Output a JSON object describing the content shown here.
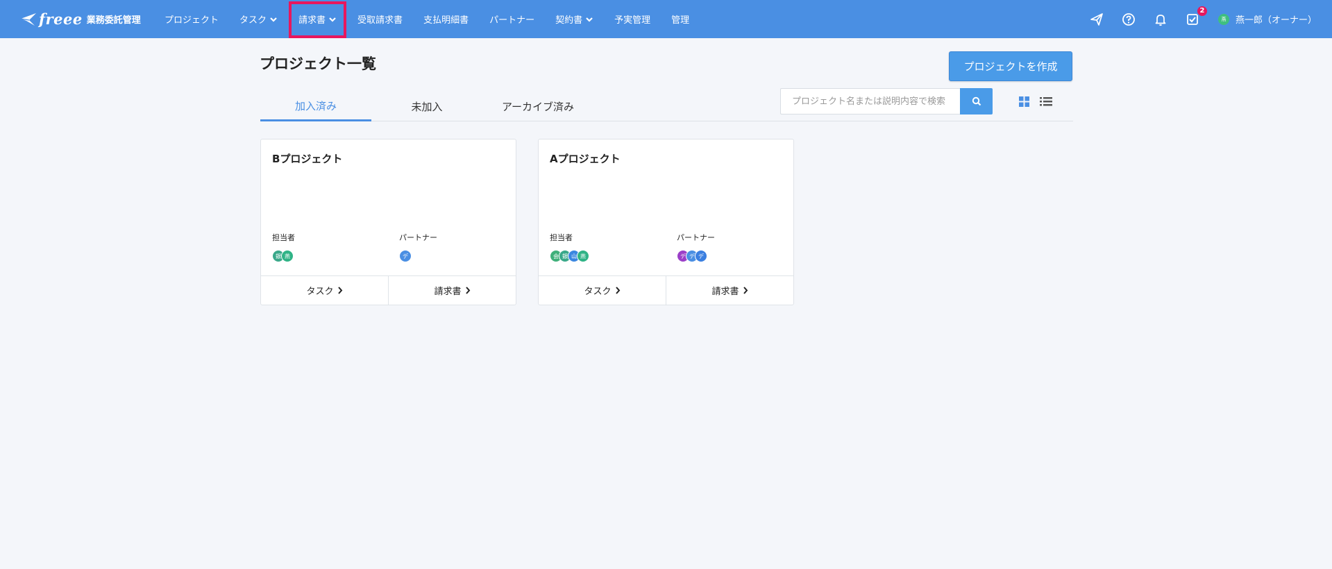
{
  "header": {
    "brand": "freee",
    "brand_sub": "業務委託管理",
    "nav": [
      {
        "label": "プロジェクト",
        "dropdown": false
      },
      {
        "label": "タスク",
        "dropdown": true
      },
      {
        "label": "請求書",
        "dropdown": true,
        "highlighted": true
      },
      {
        "label": "受取請求書",
        "dropdown": false
      },
      {
        "label": "支払明細書",
        "dropdown": false
      },
      {
        "label": "パートナー",
        "dropdown": false
      },
      {
        "label": "契約書",
        "dropdown": true
      },
      {
        "label": "予実管理",
        "dropdown": false
      },
      {
        "label": "管理",
        "dropdown": false
      }
    ],
    "icons": [
      "send-icon",
      "help-icon",
      "bell-icon",
      "task-check-icon"
    ],
    "task_badge": "2",
    "user_initial": "燕",
    "user_name": "燕一郎（オーナー）",
    "accent_color": "#4a8fe3",
    "highlight_color": "#e8175d"
  },
  "main": {
    "title": "プロジェクト一覧",
    "create_button": "プロジェクトを作成",
    "tabs": [
      {
        "label": "加入済み",
        "active": true
      },
      {
        "label": "未加入",
        "active": false
      },
      {
        "label": "アーカイブ済み",
        "active": false
      }
    ],
    "search": {
      "placeholder": "プロジェクト名または説明内容で検索",
      "value": ""
    },
    "view_modes": [
      "grid-view-icon",
      "list-view-icon"
    ],
    "cards": [
      {
        "title": "Bプロジェクト",
        "assignee_label": "担当者",
        "partner_label": "パートナー",
        "assignees": [
          {
            "initial": "銀",
            "color": "#3aa88a"
          },
          {
            "initial": "燕",
            "color": "#2fb386"
          }
        ],
        "partners": [
          {
            "initial": "デ",
            "color": "#4a8fe3"
          }
        ],
        "task_link": "タスク",
        "invoice_link": "請求書"
      },
      {
        "title": "Aプロジェクト",
        "assignee_label": "担当者",
        "partner_label": "パートナー",
        "assignees": [
          {
            "initial": "会",
            "color": "#3fb07a"
          },
          {
            "initial": "銀",
            "color": "#3aa88a"
          },
          {
            "initial": "山",
            "color": "#3b87e0"
          },
          {
            "initial": "燕",
            "color": "#2fb386"
          }
        ],
        "partners": [
          {
            "initial": "デ",
            "color": "#9b3fc8"
          },
          {
            "initial": "デ",
            "color": "#4a8fe3"
          },
          {
            "initial": "デ",
            "color": "#3b7fe0"
          }
        ],
        "task_link": "タスク",
        "invoice_link": "請求書"
      }
    ]
  }
}
